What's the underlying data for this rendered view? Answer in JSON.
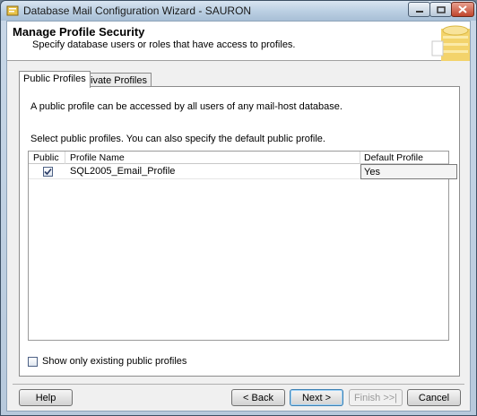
{
  "window": {
    "title": "Database Mail Configuration Wizard - SAURON"
  },
  "header": {
    "title": "Manage Profile Security",
    "subtitle": "Specify database users or roles that have access to profiles."
  },
  "tabs": [
    {
      "label": "Public Profiles",
      "active": true
    },
    {
      "label": "Private Profiles",
      "active": false
    }
  ],
  "panel": {
    "info": "A public profile can be accessed by all users of any mail-host database.",
    "select_hint": "Select public profiles. You can also specify the default public profile."
  },
  "grid": {
    "columns": [
      "Public",
      "Profile Name",
      "Default Profile"
    ],
    "rows": [
      {
        "public": true,
        "profile_name": "SQL2005_Email_Profile",
        "default_profile": "Yes"
      }
    ]
  },
  "show_only": {
    "label": "Show only existing public profiles",
    "checked": false
  },
  "buttons": {
    "help": "Help",
    "back": "< Back",
    "next": "Next >",
    "finish": "Finish >>|",
    "cancel": "Cancel"
  },
  "icons": {
    "app": "wizard-app-icon",
    "header_graphic": "database-mail-icon"
  },
  "colors": {
    "title_bar": "#bcd0e3",
    "close_button": "#c0452c",
    "default_button_border": "#3c7fb1"
  }
}
